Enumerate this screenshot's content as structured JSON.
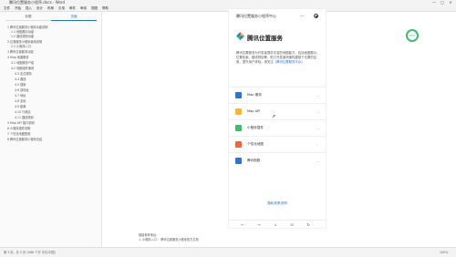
{
  "window": {
    "title": "腾讯位置服务小程序.docx - Word",
    "controls": [
      "—",
      "□",
      "×"
    ]
  },
  "menubar": {
    "items": [
      "文件",
      "开始",
      "插入",
      "设计",
      "布局",
      "引用",
      "邮件",
      "审阅",
      "视图",
      "帮助"
    ]
  },
  "left_panel": {
    "tabs": [
      "标题",
      "页面"
    ],
    "active_tab": "页面",
    "outline": [
      "1 腾讯位置服务小程序功能说明",
      "1.1 地图展示功能",
      "1.2 路线规划功能",
      "2 位置服务小程序使用说明",
      "2.1 小程序入口",
      "3 腾讯位置服务功能",
      "4 Map 地图服务",
      "4.1 地图服务介绍",
      "4.2 地图组件使用",
      "4.3 定位服务",
      "4.4 路线",
      "4.5 搜索",
      "4.6 逆地址",
      "4.7 地址",
      "4.8 坐标",
      "4.9 距离",
      "4.10 行政区",
      "4.11 路线规划",
      "5 Map API 接口说明",
      "6 小程序插件说明",
      "7 个性化地图配置",
      "8 腾讯位置服务小程序总结"
    ]
  },
  "phone": {
    "header_title": "腾讯位置服务小程序中心",
    "more_icon": "···",
    "brand_name": "腾讯位置服务",
    "intro_text": "腾讯位置服务为开发者提供丰富的地图能力，包括地图展示、位置检索、路线规划等，助力开发者快速构建基于位置的应用，提升用户体验。请关注",
    "intro_link": "《腾讯位置服务平台》",
    "menu": [
      {
        "label": "Map 服务",
        "icon": "map-service-icon",
        "color": "#2d74d6"
      },
      {
        "label": "Map API",
        "icon": "map-api-icon",
        "color": "#f5b82e"
      },
      {
        "label": "小程序插件",
        "icon": "plugin-icon",
        "color": "#3bbf6a"
      },
      {
        "label": "个性化地图",
        "icon": "custom-map-icon",
        "color": "#f0663a"
      },
      {
        "label": "腾讯指数",
        "icon": "index-icon",
        "color": "#2d74d6"
      }
    ],
    "bottom_link": "隐私政策说明",
    "toolbar": [
      "←",
      "→",
      "↓",
      "⊡",
      "↻"
    ]
  },
  "progress_badge": "36%",
  "bottom_notes": [
    "链接参考地址：",
    "1. 小程序入口 ：腾讯位置服务小程序官方文档"
  ],
  "statusbar": {
    "left": "第 3 页，共 5 页    1086 个字    中文(中国)",
    "right": "100%"
  },
  "colors": {
    "accent": "#2d74d6",
    "badge": "#3bbf6a"
  }
}
